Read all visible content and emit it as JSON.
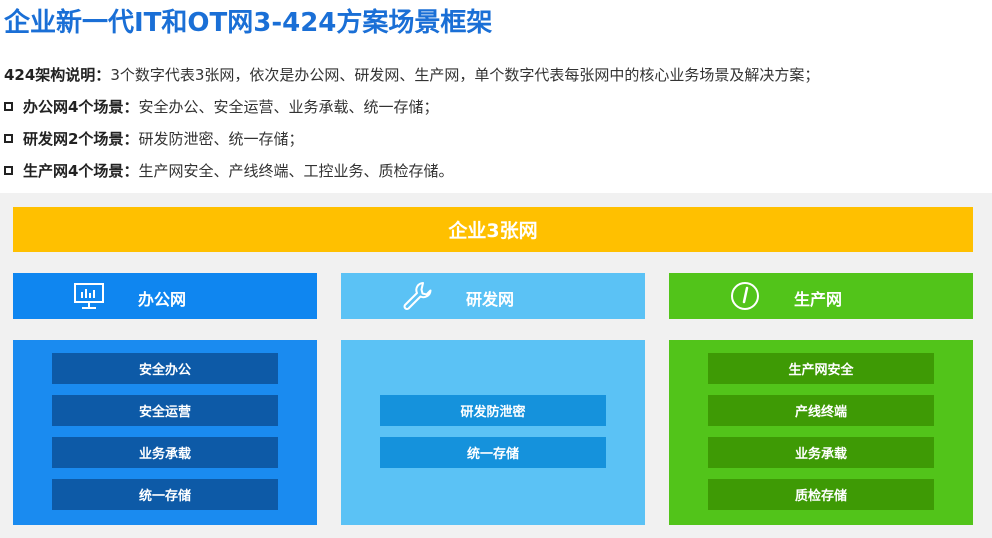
{
  "title": "企业新一代IT和OT网3-424方案场景框架",
  "intro": {
    "label": "424架构说明：",
    "text": "3个数字代表3张网，依次是办公网、研发网、生产网，单个数字代表每张网中的核心业务场景及解决方案；"
  },
  "bullets": [
    {
      "label": "办公网4个场景：",
      "text": "安全办公、安全运营、业务承载、统一存储；"
    },
    {
      "label": "研发网2个场景：",
      "text": "研发防泄密、统一存储；"
    },
    {
      "label": "生产网4个场景：",
      "text": "生产网安全、产线终端、工控业务、质检存储。"
    }
  ],
  "banner": "企业3张网",
  "columns": [
    {
      "name": "办公网",
      "icon": "monitor-icon",
      "head_color": "#0f86f0",
      "body_color": "#1a8bf0",
      "item_color": "#0d5aa7",
      "items": [
        "安全办公",
        "安全运营",
        "业务承载",
        "统一存储"
      ]
    },
    {
      "name": "研发网",
      "icon": "wrench-icon",
      "head_color": "#5bc2f5",
      "body_color": "#5bc2f5",
      "item_color": "#1592dc",
      "items": [
        "研发防泄密",
        "统一存储"
      ]
    },
    {
      "name": "生产网",
      "icon": "gauge-icon",
      "head_color": "#52c41a",
      "body_color": "#52c41a",
      "item_color": "#3e9a05",
      "items": [
        "生产网安全",
        "产线终端",
        "业务承载",
        "质检存储"
      ]
    }
  ]
}
